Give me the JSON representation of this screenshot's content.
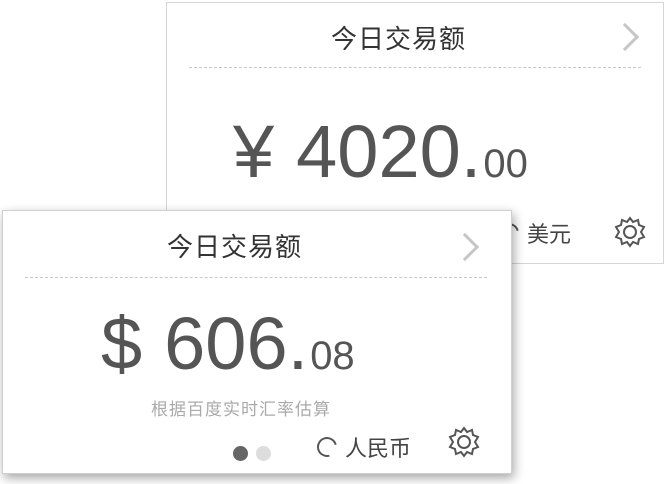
{
  "back_card": {
    "title": "今日交易额",
    "symbol": "¥",
    "amount_int": "4020.",
    "amount_dec": "00",
    "currency_label": "美元"
  },
  "front_card": {
    "title": "今日交易额",
    "symbol": "$",
    "amount_int": "606.",
    "amount_dec": "08",
    "note": "根据百度实时汇率估算",
    "currency_label": "人民币",
    "pager": {
      "total": 2,
      "active": 1
    }
  },
  "colors": {
    "text": "#333333",
    "amount": "#555555",
    "note": "#aaaaaa",
    "dot_active": "#666666",
    "dot_inactive": "#dddddd"
  }
}
